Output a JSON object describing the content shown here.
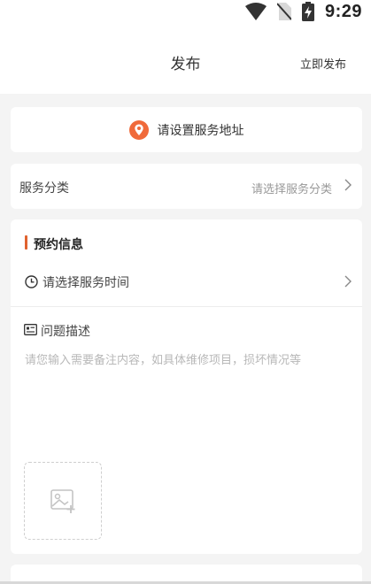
{
  "status_bar": {
    "time": "9:29",
    "icons": [
      "wifi-icon",
      "no-sim-icon",
      "battery-charging-icon"
    ]
  },
  "header": {
    "title": "发布",
    "publish_label": "立即发布"
  },
  "address": {
    "label": "请设置服务地址",
    "icon": "location-pin-icon",
    "accent_color": "#f06a3a"
  },
  "category": {
    "label": "服务分类",
    "placeholder": "请选择服务分类"
  },
  "appointment": {
    "section_title": "预约信息",
    "accent_color": "#e0622f",
    "time_label": "请选择服务时间",
    "description_label": "问题描述",
    "description_placeholder": "请您输入需要备注内容，如具体维修项目，损坏情况等",
    "upload_icon": "add-image-icon"
  }
}
